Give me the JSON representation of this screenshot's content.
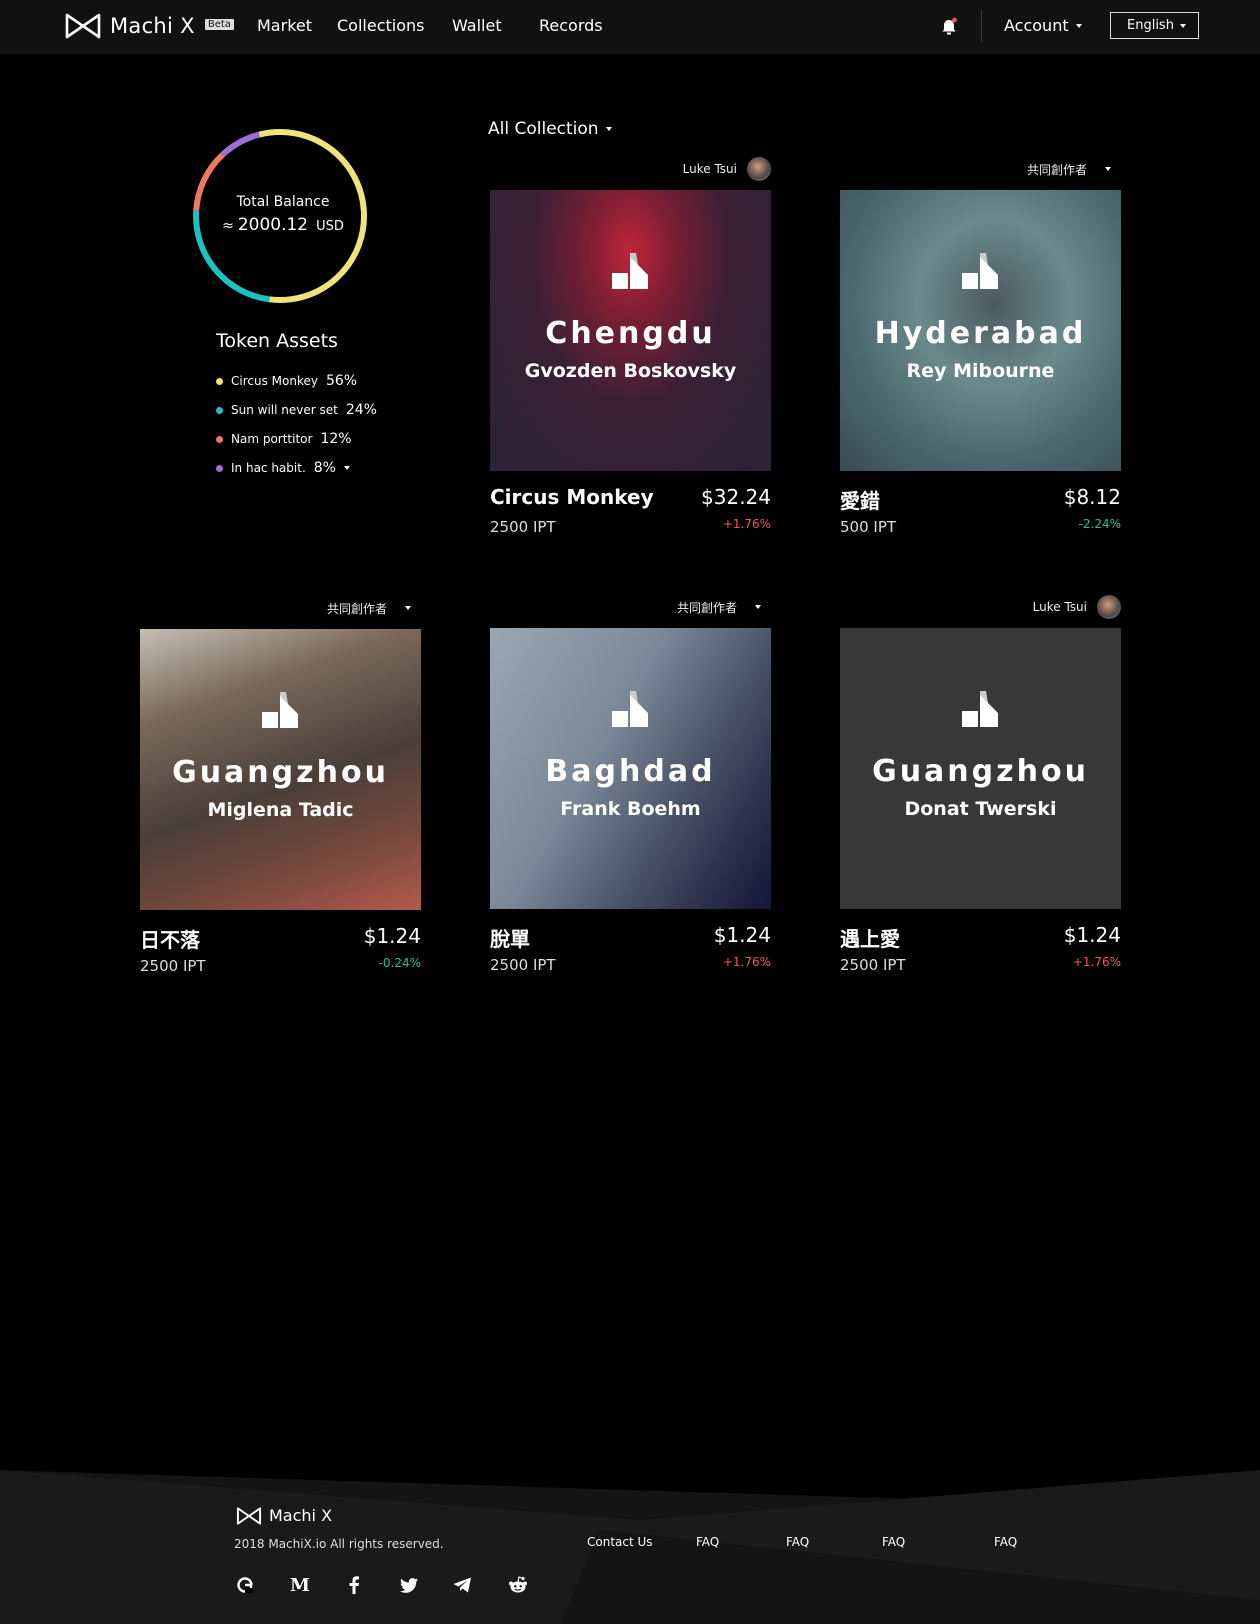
{
  "header": {
    "brand": "Machi X",
    "beta": "Beta",
    "nav": [
      "Market",
      "Collections",
      "Wallet",
      "Records"
    ],
    "account": "Account",
    "language": "English"
  },
  "balance": {
    "label": "Total Balance",
    "approx": "≈",
    "amount": "2000.12",
    "currency": "USD"
  },
  "token_assets": {
    "title": "Token Assets",
    "items": [
      {
        "name": "Circus Monkey",
        "pct": "56%",
        "value": 0.56,
        "color": "#efe47a"
      },
      {
        "name": "Sun will never set",
        "pct": "24%",
        "value": 0.24,
        "color": "#1fc0c4"
      },
      {
        "name": "Nam porttitor",
        "pct": "12%",
        "value": 0.12,
        "color": "#ee7a5e"
      },
      {
        "name": "In hac habit.",
        "pct": "8%",
        "value": 0.08,
        "color": "#9b6fd6"
      }
    ]
  },
  "collection_filter": "All Collection",
  "cards": [
    {
      "owner": "Luke Tsui",
      "owner_type": "avatar",
      "city": "Chengdu",
      "artist": "Gvozden Boskovsky",
      "name": "Circus Monkey",
      "price": "$32.24",
      "ipt": "2500 IPT",
      "change": "+1.76%",
      "trend": "up"
    },
    {
      "owner": "共同創作者",
      "owner_type": "dropdown",
      "city": "Hyderabad",
      "artist": "Rey Mibourne",
      "name": "愛錯",
      "price": "$8.12",
      "ipt": "500 IPT",
      "change": "-2.24%",
      "trend": "down"
    },
    {
      "owner": "共同創作者",
      "owner_type": "dropdown",
      "city": "Guangzhou",
      "artist": "Miglena Tadic",
      "name": "日不落",
      "price": "$1.24",
      "ipt": "2500 IPT",
      "change": "-0.24%",
      "trend": "down"
    },
    {
      "owner": "共同創作者",
      "owner_type": "dropdown",
      "city": "Baghdad",
      "artist": "Frank Boehm",
      "name": "脫單",
      "price": "$1.24",
      "ipt": "2500 IPT",
      "change": "+1.76%",
      "trend": "up"
    },
    {
      "owner": "Luke Tsui",
      "owner_type": "avatar",
      "city": "Guangzhou",
      "artist": "Donat Twerski",
      "name": "遇上愛",
      "price": "$1.24",
      "ipt": "2500 IPT",
      "change": "+1.76%",
      "trend": "up"
    }
  ],
  "footer": {
    "brand": "Machi X",
    "copyright": "2018 MachiX.io All rights reserved.",
    "links": [
      "Contact Us",
      "FAQ",
      "FAQ",
      "FAQ",
      "FAQ"
    ],
    "social": [
      "github-icon",
      "medium-icon",
      "facebook-icon",
      "twitter-icon",
      "telegram-icon",
      "reddit-icon"
    ]
  }
}
